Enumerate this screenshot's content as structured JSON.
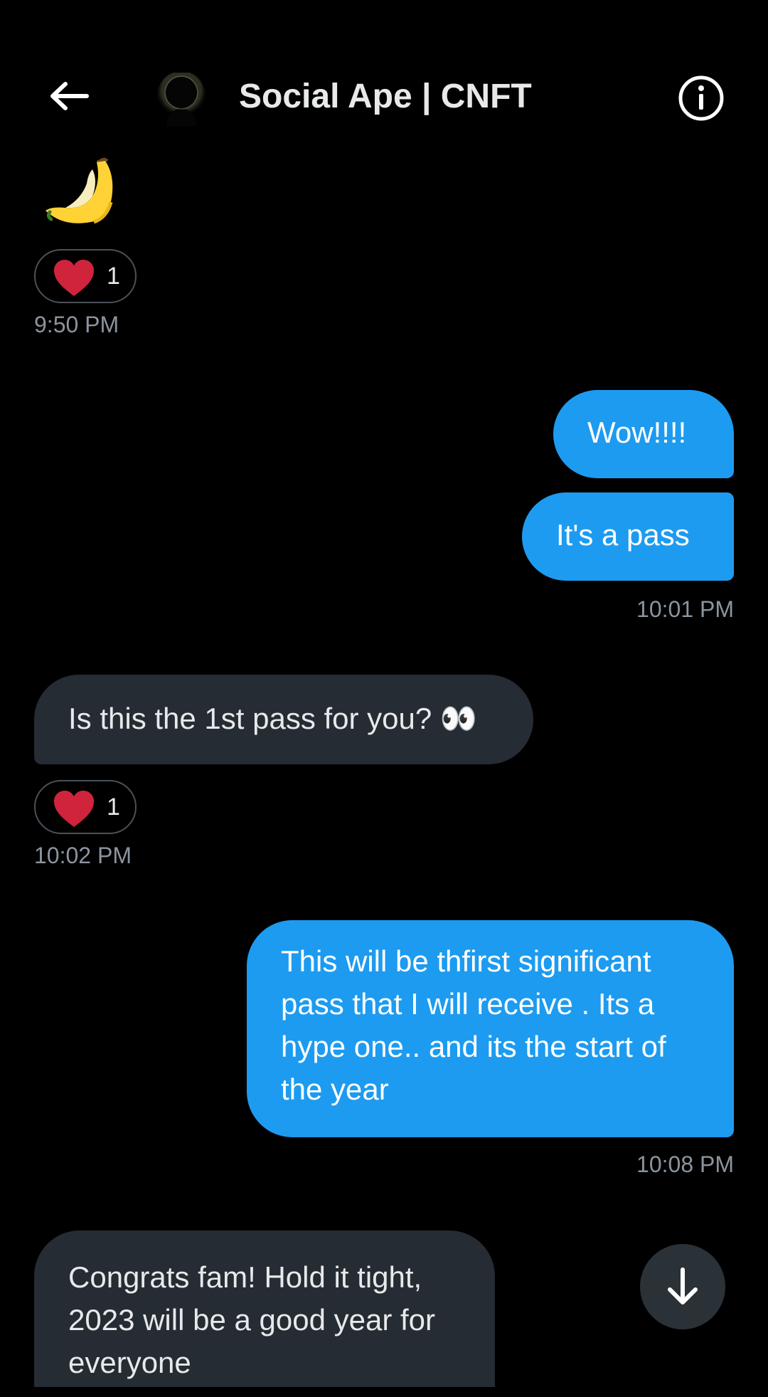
{
  "header": {
    "title": "Social Ape | CNFT",
    "back_icon": "arrow-left-icon",
    "info_icon": "info-icon"
  },
  "messages": [
    {
      "direction": "incoming",
      "content": "banana-emoji",
      "reaction": {
        "icon": "heart-icon",
        "count": "1"
      },
      "timestamp": "9:50 PM"
    },
    {
      "direction": "outgoing",
      "bubbles": [
        "Wow!!!!",
        "It's a pass"
      ],
      "timestamp": "10:01 PM"
    },
    {
      "direction": "incoming",
      "text": "Is this the 1st pass for you? 👀",
      "reaction": {
        "icon": "heart-icon",
        "count": "1"
      },
      "timestamp": "10:02 PM"
    },
    {
      "direction": "outgoing",
      "text_lines": [
        "This will be thfirst significant",
        "pass that I will receive . Its a",
        "hype one.. and its the start of",
        "the year"
      ],
      "timestamp": "10:08 PM"
    },
    {
      "direction": "incoming",
      "text_lines": [
        "Congrats fam! Hold it tight,",
        "2023 will be a good year for",
        "everyone"
      ]
    }
  ],
  "scroll_down_icon": "arrow-down-icon",
  "colors": {
    "background": "#000000",
    "outgoing_bubble": "#1d9bf0",
    "incoming_bubble": "#252c33",
    "heart": "#d0243c",
    "timestamp": "#8b949e"
  }
}
